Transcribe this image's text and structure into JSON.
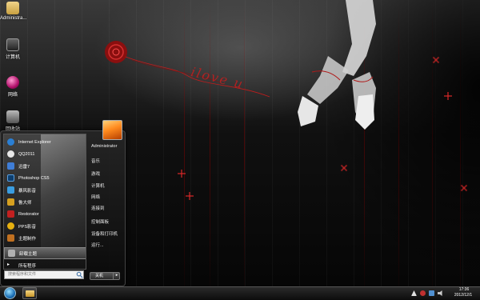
{
  "desktop": {
    "icons": [
      {
        "label": "Administra..."
      },
      {
        "label": "计算机"
      },
      {
        "label": "网络"
      },
      {
        "label": "回收站"
      }
    ],
    "wallpaper_text": "ilove u"
  },
  "start_menu": {
    "programs": [
      {
        "label": "Internet Explorer",
        "icon": "ie-icon",
        "color": "#2a7fd4"
      },
      {
        "label": "QQ2011",
        "icon": "qq-icon",
        "color": "#e8e8e8"
      },
      {
        "label": "迅雷7",
        "icon": "thunder-icon",
        "color": "#3f7dd6"
      },
      {
        "label": "Photoshop CS5",
        "icon": "photoshop-icon",
        "color": "#0d3e6e"
      },
      {
        "label": "暴风影音",
        "icon": "baofeng-icon",
        "color": "#3a9de0"
      },
      {
        "label": "鲁大师",
        "icon": "ludashi-icon",
        "color": "#d6a020"
      },
      {
        "label": "Restorator",
        "icon": "restorator-icon",
        "color": "#c22020"
      },
      {
        "label": "PPS影音",
        "icon": "pps-icon",
        "color": "#e6b010"
      },
      {
        "label": "主题制作",
        "icon": "theme-icon",
        "color": "#c07020"
      },
      {
        "label": "卸载主题",
        "icon": "uninstall-icon",
        "color": "#b0b0b0"
      }
    ],
    "all_programs": "所有程序",
    "search_placeholder": "搜索程序和文件",
    "right_items": [
      {
        "label": "Administrator"
      },
      {
        "label": "音乐"
      },
      {
        "label": "游戏"
      },
      {
        "label": "计算机"
      },
      {
        "label": "网络"
      },
      {
        "label": "连接到"
      },
      {
        "label": "控制面板"
      },
      {
        "label": "设备和打印机"
      },
      {
        "label": "运行..."
      }
    ],
    "shutdown_label": "关机",
    "shutdown_arrow": "▸"
  },
  "taskbar": {
    "time": "17:36",
    "date": "2012/12/1"
  },
  "colors": {
    "accent_red": "#b01818",
    "start_orb": "#1c6fb5"
  }
}
